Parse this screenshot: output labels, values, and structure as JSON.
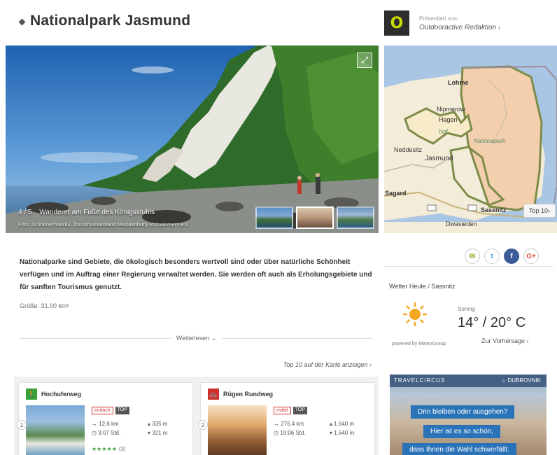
{
  "header": {
    "title": "Nationalpark Jasmund",
    "presented_by": "Präsentiert von:",
    "presenter_link": "Outdooractive Redaktion ›",
    "presenter_logo": "O"
  },
  "hero": {
    "counter": "4 / 5",
    "caption": "Wanderer am Fuße des Königsstuhls",
    "credit": "Foto: Grundner/Werk3, Tourismusverband Mecklenburg-Vorpommern e.V.",
    "expand_icon": "expand-icon"
  },
  "map": {
    "labels": {
      "lohme": "Lohme",
      "nipmerow": "Nipmerow",
      "hagen": "Hagen",
      "hof": "hof",
      "nationalpark": "Nationalpark",
      "neddesitz": "Neddesitz",
      "jasmund": "Jasmund",
      "sagard": "Sagard",
      "sassnitz": "Sassnitz",
      "dwasieden": "Dwasieden"
    },
    "top10_button": "Top 10›"
  },
  "description": {
    "text": "Nationalparke sind Gebiete, die ökologisch besonders wertvoll sind oder über natürliche Schönheit verfügen und im Auftrag einer Regierung verwaltet werden. Sie werden oft auch als Erholungsgebiete und für sanften Tourismus genutzt.",
    "area": "Größe: 31.00 km²",
    "read_more": "Weiterlesen ⌄",
    "top10_link": "Top 10 auf der Karte anzeigen ›"
  },
  "cards": [
    {
      "number": "1",
      "title": "Hochuferweg",
      "badge_trait": "einfach",
      "badge_top": "TOP",
      "distance": "↔ 12,6 km",
      "ascent": "▴ 335 m",
      "duration": "◷ 3:07 Std.",
      "descent": "▾ 321 m",
      "stars": "★★★★★",
      "rating_count": "(3)"
    },
    {
      "number": "2",
      "title": "Rügen Rundweg",
      "badge_trait": "mittel",
      "badge_top": "TOP",
      "distance": "↔ 276,4 km",
      "ascent": "▴ 1.640 m",
      "duration": "◷ 19:06 Std.",
      "descent": "▾ 1.640 m"
    }
  ],
  "share": {
    "mail": "✉",
    "twitter": "t",
    "facebook": "f",
    "google": "G+"
  },
  "weather": {
    "title": "Wetter Heute / Sassnitz",
    "condition": "Sonnig",
    "temp": "14° / 20° C",
    "powered_by": "powered by MeteoGroup",
    "forecast_link": "Zur Vorhersage ›"
  },
  "ad": {
    "brand_left": "TRAVELCIRCUS",
    "brand_right": "☼ DUBROVNIK",
    "line1": "Drin bleiben oder ausgehen?",
    "line2": "Hier ist es so schön,",
    "line3": "dass Ihnen die Wahl schwerfällt."
  },
  "colors": {
    "accent_green": "#3aa03a",
    "accent_red": "#d0312d",
    "link": "#555555",
    "map_park": "#f5d5b8",
    "map_water": "#a9c6e5"
  }
}
